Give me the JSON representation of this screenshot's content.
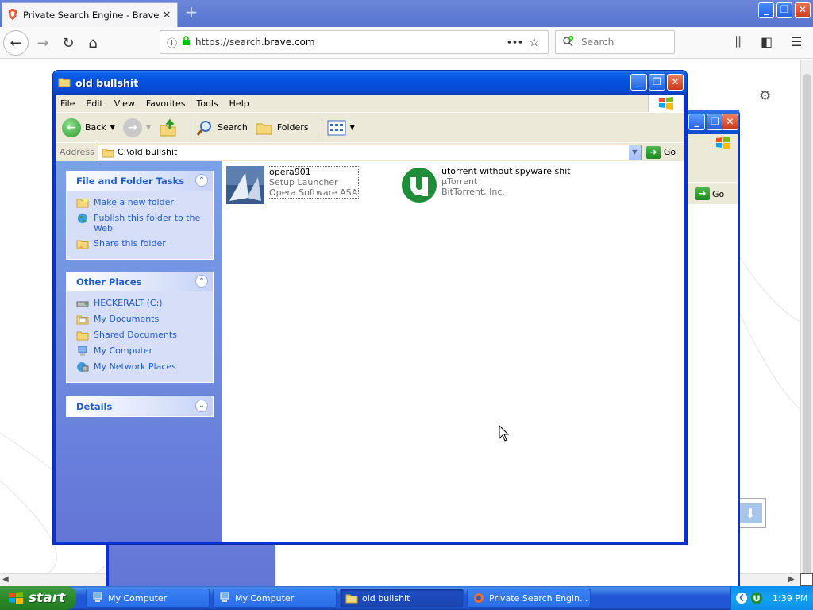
{
  "browser": {
    "tab_title": "Private Search Engine - Brave Sea",
    "url_prefix": "https://search.",
    "url_domain": "brave.com",
    "search_placeholder": "Search"
  },
  "bg_window": {
    "go_label": "Go"
  },
  "window": {
    "title": "old bullshit",
    "menu": [
      "File",
      "Edit",
      "View",
      "Favorites",
      "Tools",
      "Help"
    ],
    "toolbar": {
      "back": "Back",
      "search": "Search",
      "folders": "Folders"
    },
    "address": {
      "label": "Address",
      "value": "C:\\old bullshit",
      "go": "Go"
    },
    "panels": {
      "tasks": {
        "title": "File and Folder Tasks",
        "items": [
          "Make a new folder",
          "Publish this folder to the Web",
          "Share this folder"
        ]
      },
      "places": {
        "title": "Other Places",
        "items": [
          "HECKERALT (C:)",
          "My Documents",
          "Shared Documents",
          "My Computer",
          "My Network Places"
        ]
      },
      "details": {
        "title": "Details"
      }
    },
    "files": [
      {
        "name": "opera901",
        "line2": "Setup Launcher",
        "line3": "Opera Software ASA"
      },
      {
        "name": "utorrent without spyware shit",
        "line2": "µTorrent",
        "line3": "BitTorrent, Inc."
      }
    ]
  },
  "taskbar": {
    "start": "start",
    "buttons": [
      "My Computer",
      "My Computer",
      "old bullshit",
      "Private Search Engin..."
    ],
    "clock": "1:39 PM"
  }
}
